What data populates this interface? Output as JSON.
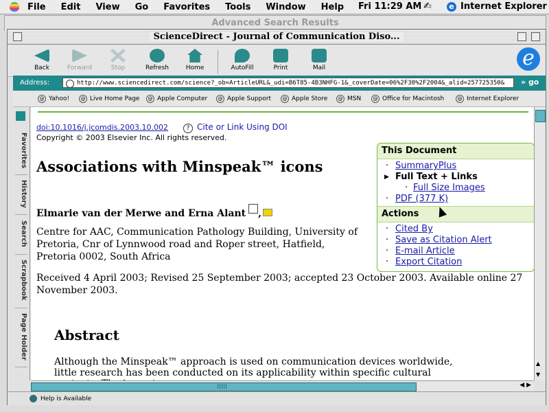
{
  "menubar": {
    "items": [
      "File",
      "Edit",
      "View",
      "Go",
      "Favorites",
      "Tools",
      "Window",
      "Help"
    ],
    "clock": "Fri 11:29 AM",
    "app_name": "Internet Explorer"
  },
  "background_window": {
    "title": "Advanced Search Results"
  },
  "window": {
    "title": "ScienceDirect - Journal of Communication Diso..."
  },
  "toolbar": {
    "back": "Back",
    "forward": "Forward",
    "stop": "Stop",
    "refresh": "Refresh",
    "home": "Home",
    "autofill": "AutoFill",
    "print": "Print",
    "mail": "Mail"
  },
  "address_bar": {
    "label": "Address:",
    "url": "http://www.sciencedirect.com/science?_ob=ArticleURL&_udi=B6T85-4B3NHFG-1&_coverDate=06%2F30%2F2004&_alid=257725350&",
    "go": "go"
  },
  "favorites_bar": {
    "items": [
      "Yahoo!",
      "Live Home Page",
      "Apple Computer",
      "Apple Support",
      "Apple Store",
      "MSN",
      "Office for Macintosh",
      "Internet Explorer"
    ]
  },
  "side_tabs": [
    "Favorites",
    "History",
    "Search",
    "Scrapbook",
    "Page Holder"
  ],
  "article": {
    "doi": "doi:10.1016/j.jcomdis.2003.10.002",
    "cite_link": "Cite or Link Using DOI",
    "copyright": "Copyright © 2003 Elsevier Inc. All rights reserved.",
    "title": "Associations with Minspeak™ icons",
    "authors": "Elmarie van der Merwe and Erna Alant",
    "affiliation": "Centre for AAC, Communication Pathology Building, University of Pretoria, Cnr of Lynnwood road and Roper street, Hatfield, Pretoria 0002, South Africa",
    "received": "Received 4 April 2003;  Revised 25 September 2003;  accepted 23 October 2003.  Available online 27 November 2003.",
    "abstract_heading": "Abstract",
    "abstract_text": "Although the Minspeak™ approach is used on communication devices worldwide, little research has been conducted on its applicability within specific cultural contexts. The impact"
  },
  "this_document": {
    "heading": "This Document",
    "summary": "SummaryPlus",
    "fulltext": "Full Text + Links",
    "images": "Full Size Images",
    "pdf": "PDF (377 K)"
  },
  "actions": {
    "heading": "Actions",
    "cited_by": "Cited By",
    "save_alert": "Save as Citation Alert",
    "email": "E-mail Article",
    "export": "Export Citation"
  },
  "status": {
    "text": "Help is Available"
  }
}
